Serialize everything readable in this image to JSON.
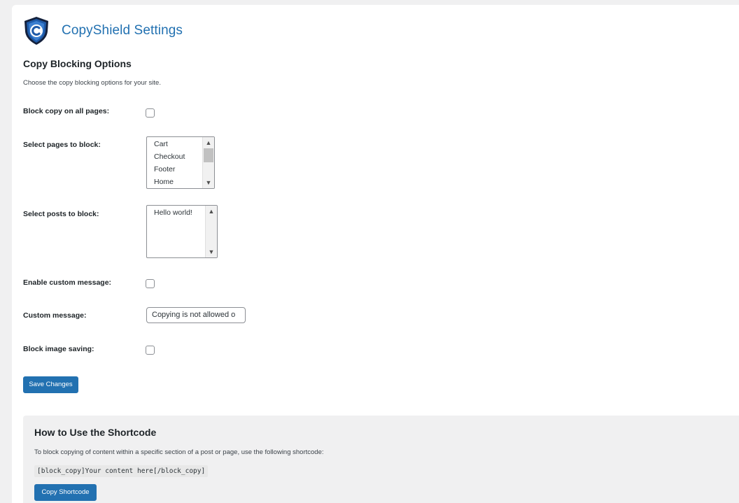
{
  "header": {
    "title": "CopyShield Settings"
  },
  "section": {
    "title": "Copy Blocking Options",
    "description": "Choose the copy blocking options for your site."
  },
  "form": {
    "block_all": {
      "label": "Block copy on all pages:"
    },
    "pages": {
      "label": "Select pages to block:",
      "options": [
        "Cart",
        "Checkout",
        "Footer",
        "Home"
      ]
    },
    "posts": {
      "label": "Select posts to block:",
      "options": [
        "Hello world!"
      ]
    },
    "enable_custom": {
      "label": "Enable custom message:"
    },
    "custom_message": {
      "label": "Custom message:",
      "value": "Copying is not allowed o"
    },
    "block_images": {
      "label": "Block image saving:"
    },
    "save_label": "Save Changes"
  },
  "howto": {
    "title": "How to Use the Shortcode",
    "description": "To block copying of content within a specific section of a post or page, use the following shortcode:",
    "code": "[block_copy]Your content here[/block_copy]",
    "copy_label": "Copy Shortcode"
  },
  "colors": {
    "accent": "#2271b1",
    "logo_dark": "#14213d",
    "logo_blue": "#1e5aa8"
  }
}
